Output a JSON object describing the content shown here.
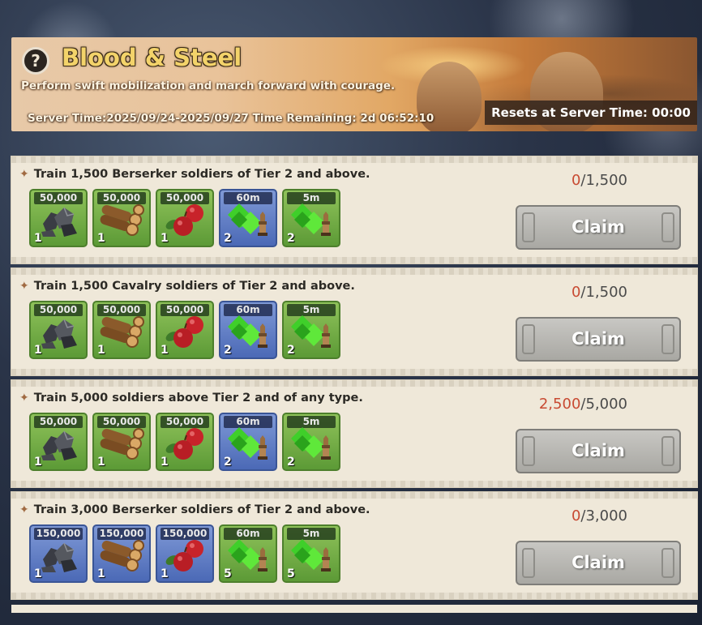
{
  "event": {
    "title": "Blood & Steel",
    "subtitle": "Perform swift mobilization and march forward with courage.",
    "server_time_label": "Server Time:2025/09/24-2025/09/27",
    "time_remaining_label": "Time Remaining: 2d 06:52:10",
    "reset_label": "Resets at Server Time:  00:00",
    "help_glyph": "?"
  },
  "tasks": [
    {
      "title": "Train 1,500 Berserker soldiers of Tier 2 and above.",
      "progress_current": "0",
      "progress_total": "/1,500",
      "claim_label": "Claim",
      "rewards": [
        {
          "icon": "iron-ore-icon",
          "top": "50,000",
          "count": "1",
          "tier": "green"
        },
        {
          "icon": "wood-logs-icon",
          "top": "50,000",
          "count": "1",
          "tier": "green"
        },
        {
          "icon": "food-apple-icon",
          "top": "50,000",
          "count": "1",
          "tier": "green"
        },
        {
          "icon": "training-speedup-icon",
          "top": "60m",
          "count": "2",
          "tier": "blue"
        },
        {
          "icon": "training-speedup-icon",
          "top": "5m",
          "count": "2",
          "tier": "green"
        }
      ]
    },
    {
      "title": "Train 1,500 Cavalry soldiers of Tier 2 and above.",
      "progress_current": "0",
      "progress_total": "/1,500",
      "claim_label": "Claim",
      "rewards": [
        {
          "icon": "iron-ore-icon",
          "top": "50,000",
          "count": "1",
          "tier": "green"
        },
        {
          "icon": "wood-logs-icon",
          "top": "50,000",
          "count": "1",
          "tier": "green"
        },
        {
          "icon": "food-apple-icon",
          "top": "50,000",
          "count": "1",
          "tier": "green"
        },
        {
          "icon": "training-speedup-icon",
          "top": "60m",
          "count": "2",
          "tier": "blue"
        },
        {
          "icon": "training-speedup-icon",
          "top": "5m",
          "count": "2",
          "tier": "green"
        }
      ]
    },
    {
      "title": "Train 5,000 soldiers above Tier 2 and of any type.",
      "progress_current": "2,500",
      "progress_total": "/5,000",
      "claim_label": "Claim",
      "rewards": [
        {
          "icon": "iron-ore-icon",
          "top": "50,000",
          "count": "1",
          "tier": "green"
        },
        {
          "icon": "wood-logs-icon",
          "top": "50,000",
          "count": "1",
          "tier": "green"
        },
        {
          "icon": "food-apple-icon",
          "top": "50,000",
          "count": "1",
          "tier": "green"
        },
        {
          "icon": "training-speedup-icon",
          "top": "60m",
          "count": "2",
          "tier": "blue"
        },
        {
          "icon": "training-speedup-icon",
          "top": "5m",
          "count": "2",
          "tier": "green"
        }
      ]
    },
    {
      "title": "Train 3,000 Berserker soldiers of Tier 2 and above.",
      "progress_current": "0",
      "progress_total": "/3,000",
      "claim_label": "Claim",
      "rewards": [
        {
          "icon": "iron-ore-icon",
          "top": "150,000",
          "count": "1",
          "tier": "blue"
        },
        {
          "icon": "wood-logs-icon",
          "top": "150,000",
          "count": "1",
          "tier": "blue"
        },
        {
          "icon": "food-apple-icon",
          "top": "150,000",
          "count": "1",
          "tier": "blue"
        },
        {
          "icon": "training-speedup-icon",
          "top": "60m",
          "count": "5",
          "tier": "green"
        },
        {
          "icon": "training-speedup-icon",
          "top": "5m",
          "count": "5",
          "tier": "green"
        }
      ]
    }
  ],
  "colors": {
    "progress_current": "#c84a32",
    "title_gold": "#f3d36a"
  }
}
